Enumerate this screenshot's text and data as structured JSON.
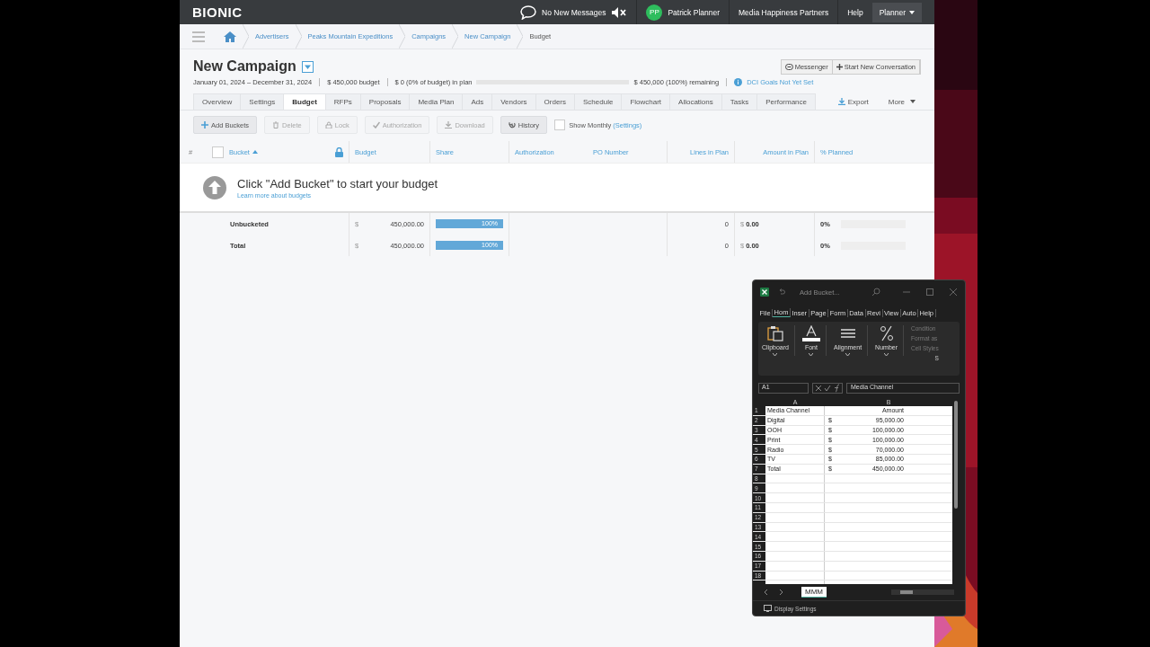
{
  "topbar": {
    "logo": "BIONIC",
    "messages": "No New Messages",
    "user_initials": "PP",
    "user_name": "Patrick Planner",
    "organization": "Media Happiness Partners",
    "help": "Help",
    "role": "Planner"
  },
  "breadcrumbs": [
    {
      "label": "Advertisers",
      "kind": "link"
    },
    {
      "label": "Peaks Mountain Expeditions",
      "kind": "link"
    },
    {
      "label": "Campaigns",
      "kind": "link"
    },
    {
      "label": "New Campaign",
      "kind": "link"
    },
    {
      "label": "Budget",
      "kind": "current"
    }
  ],
  "title": "New Campaign",
  "header_buttons": [
    "Messenger",
    "Start New Conversation"
  ],
  "summary": {
    "dates": "January 01, 2024 – December 31, 2024",
    "budget": "$ 450,000 budget",
    "in_plan": "$ 0 (0% of budget) in plan",
    "level": 0,
    "remaining": "$ 450,000 (100%) remaining",
    "goals": "DCI Goals Not Yet Set"
  },
  "tabs": [
    {
      "label": "Overview",
      "selected": false
    },
    {
      "label": "Settings",
      "selected": false
    },
    {
      "label": "Budget",
      "selected": true
    },
    {
      "label": "RFPs",
      "selected": false
    },
    {
      "label": "Proposals",
      "selected": false
    },
    {
      "label": "Media Plan",
      "selected": false
    },
    {
      "label": "Ads",
      "selected": false
    },
    {
      "label": "Vendors",
      "selected": false
    },
    {
      "label": "Orders",
      "selected": false
    },
    {
      "label": "Schedule",
      "selected": false
    },
    {
      "label": "Flowchart",
      "selected": false
    },
    {
      "label": "Allocations",
      "selected": false
    },
    {
      "label": "Tasks",
      "selected": false
    },
    {
      "label": "Performance",
      "selected": false
    }
  ],
  "tab_actions": {
    "export": "Export",
    "more": "More"
  },
  "toolbar": [
    {
      "label": "Add Buckets",
      "kind": "add",
      "disabled": false
    },
    {
      "label": "Delete",
      "kind": "delete",
      "disabled": true
    },
    {
      "label": "Lock",
      "kind": "lock",
      "disabled": true
    },
    {
      "label": "Authorization",
      "kind": "authorize",
      "disabled": true
    },
    {
      "label": "Download",
      "kind": "download",
      "disabled": true
    },
    {
      "label": "History",
      "kind": "history",
      "disabled": false
    }
  ],
  "show_monthly": {
    "label": "Show Monthly",
    "link": "(Settings)",
    "checked": false
  },
  "table": {
    "select_all": {
      "checked": false
    },
    "columns": [
      "#",
      "Bucket",
      "Budget",
      "Share",
      "Authorization",
      "PO Number",
      "Lines in Plan",
      "Amount in Plan",
      "% Planned"
    ],
    "empty_message": "Click \"Add Bucket\" to start your budget",
    "empty_link": "Learn more about budgets",
    "rows": [
      {
        "name": "Unbucketed",
        "currency": "$",
        "budget": "450,000.00",
        "share": {
          "text": "100%",
          "level": 1
        },
        "lines": "0",
        "amount_currency": "$",
        "amount": "0.00",
        "planned": {
          "text": "0%",
          "level": 0
        }
      },
      {
        "name": "Total",
        "currency": "$",
        "budget": "450,000.00",
        "share": {
          "text": "100%",
          "level": 1
        },
        "lines": "0",
        "amount_currency": "$",
        "amount": "0.00",
        "planned": {
          "text": "0%",
          "level": 0
        }
      }
    ]
  },
  "excel": {
    "title": "Add Bucket...",
    "ribbon_tabs": [
      {
        "label": "File",
        "selected": false
      },
      {
        "label": "Hom",
        "selected": true
      },
      {
        "label": "Inser",
        "selected": false
      },
      {
        "label": "Page",
        "selected": false
      },
      {
        "label": "Form",
        "selected": false
      },
      {
        "label": "Data",
        "selected": false
      },
      {
        "label": "Revi",
        "selected": false
      },
      {
        "label": "View",
        "selected": false
      },
      {
        "label": "Auto",
        "selected": false
      },
      {
        "label": "Help",
        "selected": false
      }
    ],
    "groups": [
      {
        "label": "Clipboard",
        "kind": "clipboard"
      },
      {
        "label": "Font",
        "kind": "font"
      },
      {
        "label": "Alignment",
        "kind": "alignment"
      },
      {
        "label": "Number",
        "kind": "number"
      }
    ],
    "styles": [
      "Condition",
      "Format as",
      "Cell Styles"
    ],
    "styles_label": "S",
    "name_box": "A1",
    "formula": "Media Channel",
    "columns": [
      "A",
      "B"
    ],
    "rows": [
      {
        "n": "1",
        "a": "Media Channel",
        "cur": "",
        "b": "Amount"
      },
      {
        "n": "2",
        "a": "Digital",
        "cur": "$",
        "b": "95,000.00"
      },
      {
        "n": "3",
        "a": "OOH",
        "cur": "$",
        "b": "100,000.00"
      },
      {
        "n": "4",
        "a": "Print",
        "cur": "$",
        "b": "100,000.00"
      },
      {
        "n": "5",
        "a": "Radio",
        "cur": "$",
        "b": "70,000.00"
      },
      {
        "n": "6",
        "a": "TV",
        "cur": "$",
        "b": "85,000.00"
      },
      {
        "n": "7",
        "a": "Total",
        "cur": "$",
        "b": "450,000.00"
      },
      {
        "n": "8"
      },
      {
        "n": "9"
      },
      {
        "n": "10"
      },
      {
        "n": "11"
      },
      {
        "n": "12"
      },
      {
        "n": "13"
      },
      {
        "n": "14"
      },
      {
        "n": "15"
      },
      {
        "n": "16"
      },
      {
        "n": "17"
      },
      {
        "n": "18"
      }
    ],
    "sheet_tab": "MMM",
    "status": "Display Settings"
  }
}
